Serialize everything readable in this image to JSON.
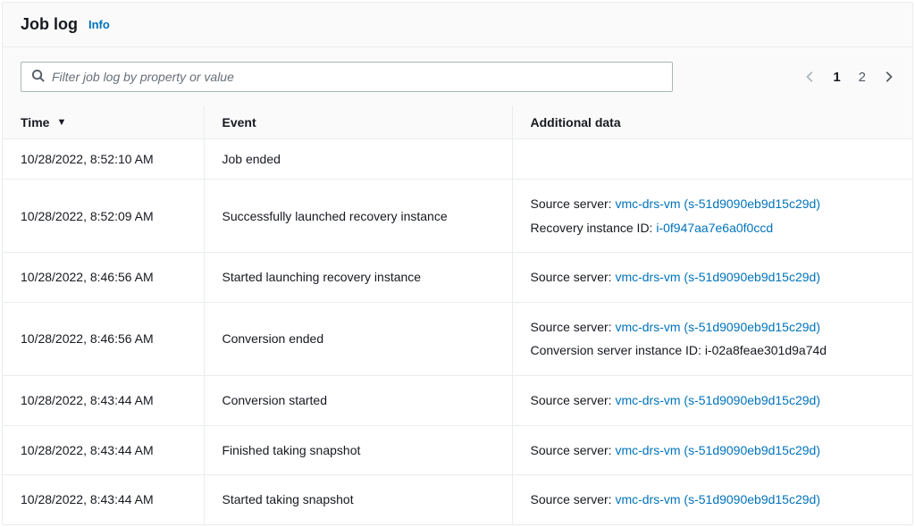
{
  "header": {
    "title": "Job log",
    "info_label": "Info"
  },
  "search": {
    "placeholder": "Filter job log by property or value"
  },
  "pagination": {
    "current": "1",
    "other": "2"
  },
  "columns": {
    "time": "Time",
    "event": "Event",
    "additional": "Additional data"
  },
  "labels": {
    "source_server": "Source server: ",
    "recovery_instance_id": "Recovery instance ID: ",
    "conversion_server_instance_id": "Conversion server instance ID: "
  },
  "rows": [
    {
      "time": "10/28/2022, 8:52:10 AM",
      "event": "Job ended",
      "additional": []
    },
    {
      "time": "10/28/2022, 8:52:09 AM",
      "event": "Successfully launched recovery instance",
      "additional": [
        {
          "label_key": "source_server",
          "link": "vmc-drs-vm (s-51d9090eb9d15c29d)"
        },
        {
          "label_key": "recovery_instance_id",
          "link": "i-0f947aa7e6a0f0ccd"
        }
      ]
    },
    {
      "time": "10/28/2022, 8:46:56 AM",
      "event": "Started launching recovery instance",
      "additional": [
        {
          "label_key": "source_server",
          "link": "vmc-drs-vm (s-51d9090eb9d15c29d)"
        }
      ]
    },
    {
      "time": "10/28/2022, 8:46:56 AM",
      "event": "Conversion ended",
      "additional": [
        {
          "label_key": "source_server",
          "link": "vmc-drs-vm (s-51d9090eb9d15c29d)"
        },
        {
          "label_key": "conversion_server_instance_id",
          "text": "i-02a8feae301d9a74d"
        }
      ]
    },
    {
      "time": "10/28/2022, 8:43:44 AM",
      "event": "Conversion started",
      "additional": [
        {
          "label_key": "source_server",
          "link": "vmc-drs-vm (s-51d9090eb9d15c29d)"
        }
      ]
    },
    {
      "time": "10/28/2022, 8:43:44 AM",
      "event": "Finished taking snapshot",
      "additional": [
        {
          "label_key": "source_server",
          "link": "vmc-drs-vm (s-51d9090eb9d15c29d)"
        }
      ]
    },
    {
      "time": "10/28/2022, 8:43:44 AM",
      "event": "Started taking snapshot",
      "additional": [
        {
          "label_key": "source_server",
          "link": "vmc-drs-vm (s-51d9090eb9d15c29d)"
        }
      ]
    }
  ]
}
